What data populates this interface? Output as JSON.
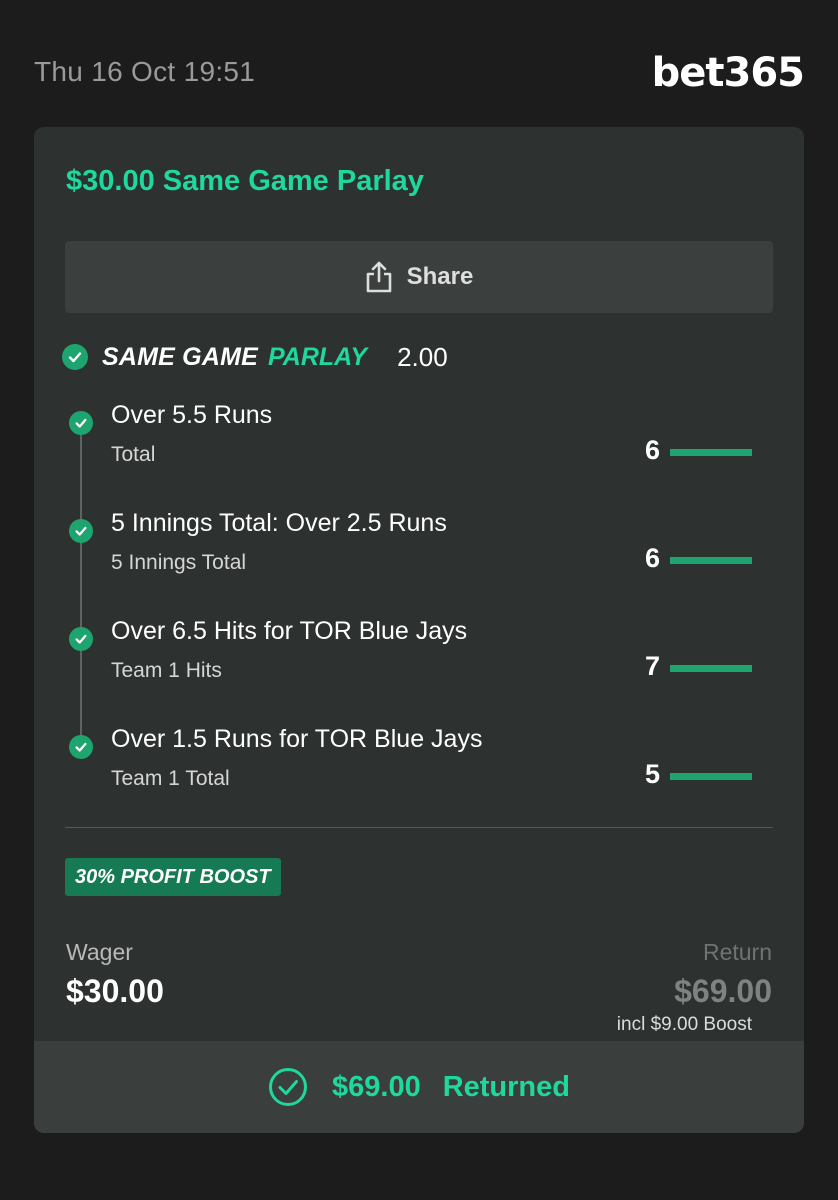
{
  "header": {
    "date": "Thu 16 Oct 19:51",
    "brand": "bet365"
  },
  "bet": {
    "title": "$30.00 Same Game Parlay",
    "share_label": "Share",
    "parlay_word_1": "SAME GAME",
    "parlay_word_2": "PARLAY",
    "odds": "2.00",
    "legs": [
      {
        "title": "Over 5.5 Runs",
        "market": "Total",
        "result": "6"
      },
      {
        "title": "5 Innings Total: Over 2.5 Runs",
        "market": "5 Innings Total",
        "result": "6"
      },
      {
        "title": "Over 6.5 Hits for TOR Blue Jays",
        "market": "Team 1 Hits",
        "result": "7"
      },
      {
        "title": "Over 1.5 Runs for TOR Blue Jays",
        "market": "Team 1 Total",
        "result": "5"
      }
    ],
    "boost_badge": "30% PROFIT BOOST",
    "wager_label": "Wager",
    "wager_value": "$30.00",
    "return_label": "Return",
    "return_value": "$69.00",
    "return_note": "incl $9.00 Boost",
    "footer_amount": "$69.00",
    "footer_status": "Returned"
  },
  "colors": {
    "accent": "#1fd89d",
    "check": "#1ea56f",
    "card": "#2d312f",
    "background": "#1c1c1c"
  },
  "icons": {
    "share": "share-icon",
    "check": "check-circle-icon",
    "returned": "check-circle-outline-icon"
  }
}
